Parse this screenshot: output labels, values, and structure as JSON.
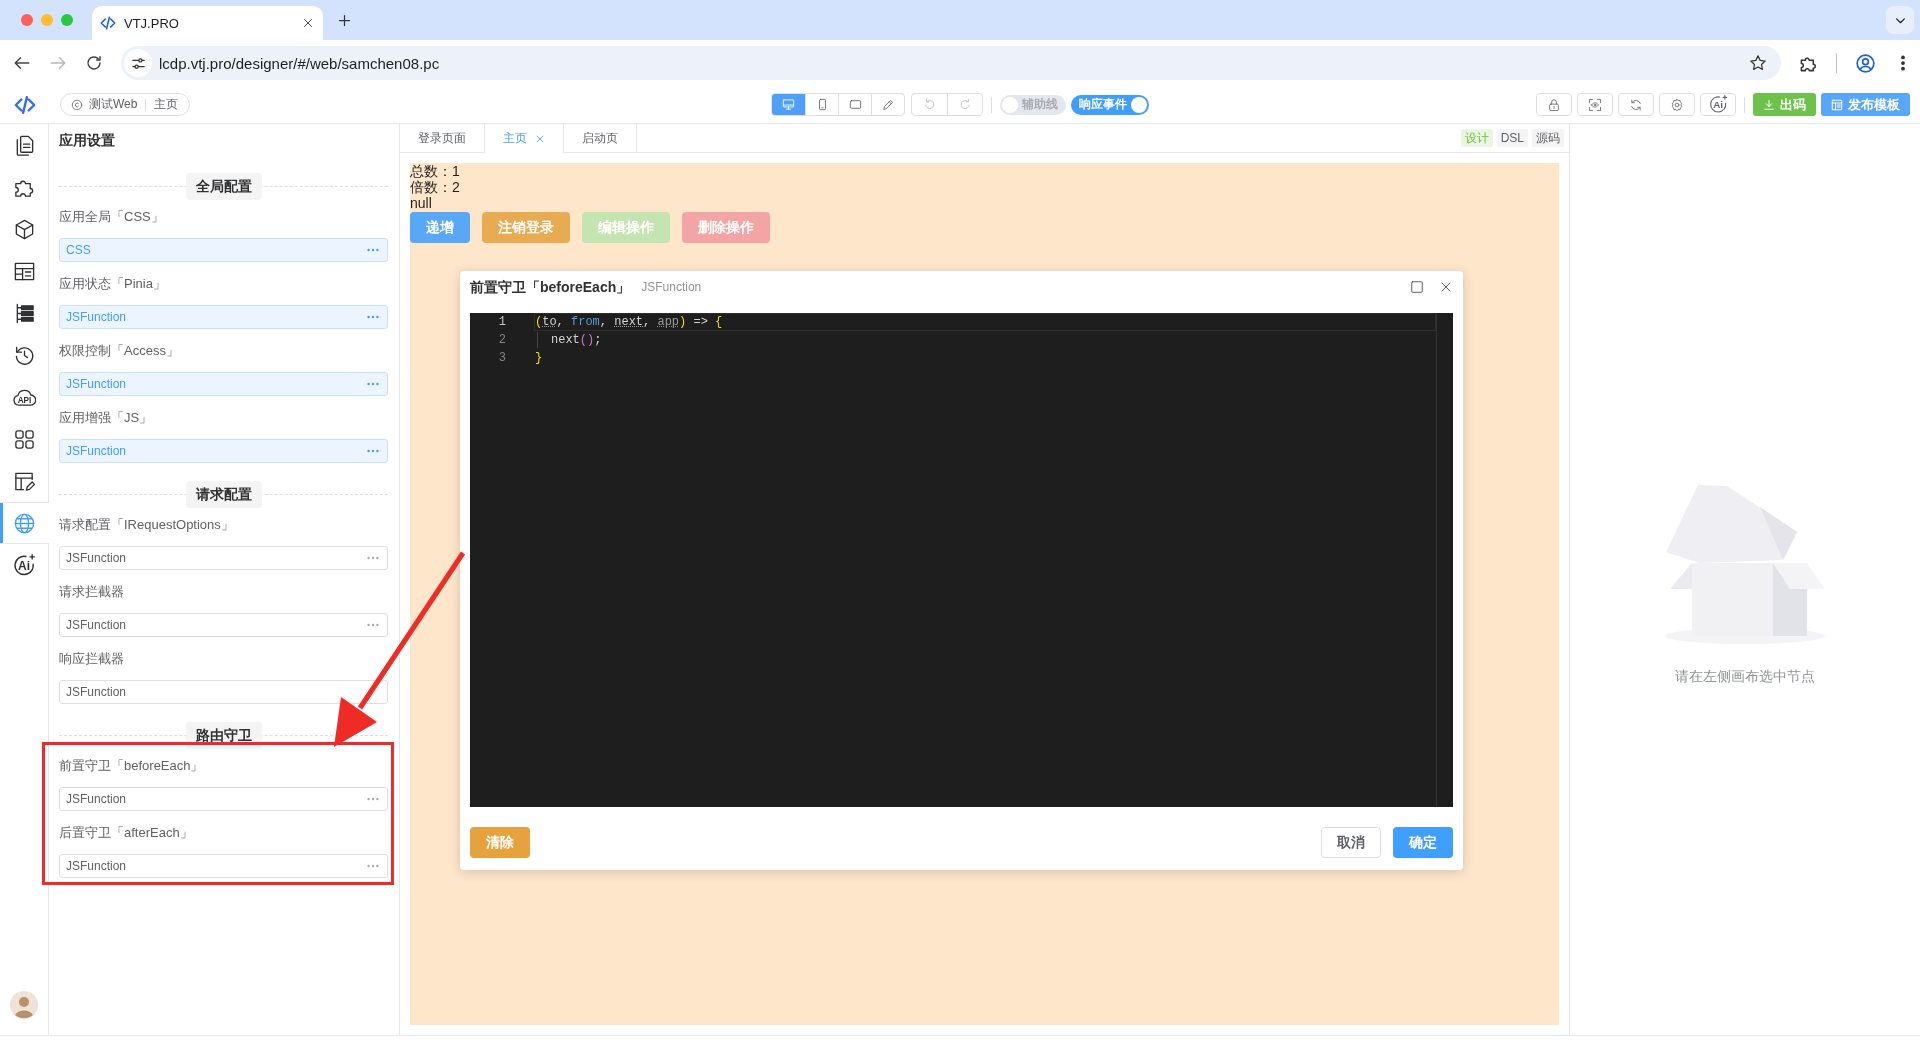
{
  "browser": {
    "tab_title": "VTJ.PRO",
    "nav": [
      {
        "kind": "back",
        "disabled": false
      },
      {
        "kind": "forward",
        "disabled": true
      },
      {
        "kind": "reload",
        "disabled": false
      }
    ],
    "url": "lcdp.vtj.pro/designer/#/web/samchen08.pc"
  },
  "toolbar": {
    "breadcrumb": [
      "测试Web",
      "主页"
    ],
    "view_modes": [
      {
        "kind": "desktop",
        "selected": true
      },
      {
        "kind": "mobile",
        "selected": false
      },
      {
        "kind": "tablet",
        "selected": false
      },
      {
        "kind": "pen",
        "selected": false
      }
    ],
    "history": [
      {
        "kind": "undo",
        "disabled": true
      },
      {
        "kind": "redo",
        "disabled": true
      }
    ],
    "switches": [
      {
        "label": "辅助线",
        "on": false
      },
      {
        "label": "响应事件",
        "on": true
      }
    ],
    "tools": [
      {
        "kind": "lock"
      },
      {
        "kind": "preview"
      },
      {
        "kind": "refresh"
      },
      {
        "kind": "settings"
      },
      {
        "kind": "ai",
        "label": "Ai"
      }
    ],
    "actions": [
      {
        "kind": "export",
        "label": "出码"
      },
      {
        "kind": "publish",
        "label": "发布模板"
      }
    ]
  },
  "rail": [
    {
      "kind": "pages",
      "selected": false
    },
    {
      "kind": "components",
      "selected": false
    },
    {
      "kind": "blocks",
      "selected": false
    },
    {
      "kind": "layout",
      "selected": false
    },
    {
      "kind": "outline",
      "selected": false
    },
    {
      "kind": "history",
      "selected": false
    },
    {
      "kind": "api",
      "label": "API",
      "selected": false
    },
    {
      "kind": "apps",
      "selected": false
    },
    {
      "kind": "forms",
      "selected": false
    },
    {
      "kind": "globals",
      "selected": true
    },
    {
      "kind": "ai",
      "label": "Ai",
      "selected": false
    }
  ],
  "settings": {
    "title": "应用设置",
    "sections": [
      {
        "title": "全局配置",
        "fields": [
          {
            "label": "应用全局「CSS」",
            "value": "CSS",
            "filled": true,
            "more_button": true
          },
          {
            "label": "应用状态「Pinia」",
            "value": "JSFunction",
            "filled": true,
            "more_button": true
          },
          {
            "label": "权限控制「Access」",
            "value": "JSFunction",
            "filled": true,
            "more_button": true
          },
          {
            "label": "应用增强「JS」",
            "value": "JSFunction",
            "filled": true,
            "more_button": true
          }
        ]
      },
      {
        "title": "请求配置",
        "fields": [
          {
            "label": "请求配置「IRequestOptions」",
            "value": "JSFunction",
            "filled": false,
            "more_button": true
          },
          {
            "label": "请求拦截器",
            "value": "JSFunction",
            "filled": false,
            "more_button": true
          },
          {
            "label": "响应拦截器",
            "value": "JSFunction",
            "filled": false,
            "more_button": false
          }
        ]
      },
      {
        "title": "路由守卫",
        "fields": [
          {
            "label": "前置守卫「beforeEach」",
            "value": "JSFunction",
            "filled": false,
            "more_button": true
          },
          {
            "label": "后置守卫「afterEach」",
            "value": "JSFunction",
            "filled": false,
            "more_button": true
          }
        ]
      }
    ]
  },
  "designer": {
    "tabs": [
      {
        "label": "登录页面",
        "selected": false,
        "closable": false
      },
      {
        "label": "主页",
        "selected": true,
        "closable": true
      },
      {
        "label": "启动页",
        "selected": false,
        "closable": false
      }
    ],
    "views": [
      {
        "label": "设计",
        "selected": true
      },
      {
        "label": "DSL",
        "selected": false
      },
      {
        "label": "源码",
        "selected": false
      }
    ],
    "canvas": {
      "lines": [
        "总数：1",
        "倍数：2",
        "null"
      ],
      "buttons": [
        {
          "label": "递增",
          "kind": "primary",
          "disabled": false
        },
        {
          "label": "注销登录",
          "kind": "warning",
          "disabled": false
        },
        {
          "label": "编辑操作",
          "kind": "success",
          "disabled": true
        },
        {
          "label": "删除操作",
          "kind": "danger",
          "disabled": true
        }
      ]
    },
    "dialog": {
      "title": "前置守卫「beforeEach」",
      "subtitle": "JSFunction",
      "code": [
        {
          "number": "1",
          "active": true,
          "indented": false,
          "tokens": [
            {
              "text": "(",
              "kind": "bracket"
            },
            {
              "text": "to",
              "kind": "hint"
            },
            {
              "text": ", ",
              "kind": "text"
            },
            {
              "text": "from",
              "kind": "keyword"
            },
            {
              "text": ", ",
              "kind": "text"
            },
            {
              "text": "next",
              "kind": "hint"
            },
            {
              "text": ", ",
              "kind": "text"
            },
            {
              "text": "app",
              "kind": "unused"
            },
            {
              "text": ")",
              "kind": "bracket"
            },
            {
              "text": " => ",
              "kind": "text"
            },
            {
              "text": "{",
              "kind": "bracket"
            }
          ]
        },
        {
          "number": "2",
          "active": false,
          "indented": true,
          "tokens": [
            {
              "text": "next",
              "kind": "text"
            },
            {
              "text": "()",
              "kind": "call"
            },
            {
              "text": ";",
              "kind": "text"
            }
          ]
        },
        {
          "number": "3",
          "active": false,
          "indented": false,
          "tokens": [
            {
              "text": "}",
              "kind": "bracket"
            }
          ]
        }
      ],
      "buttons": [
        {
          "label": "清除",
          "kind": "warning"
        },
        {
          "label": "取消",
          "kind": "default"
        },
        {
          "label": "确定",
          "kind": "primary"
        }
      ]
    }
  },
  "properties": {
    "empty_text": "请在左侧画布选中节点"
  }
}
